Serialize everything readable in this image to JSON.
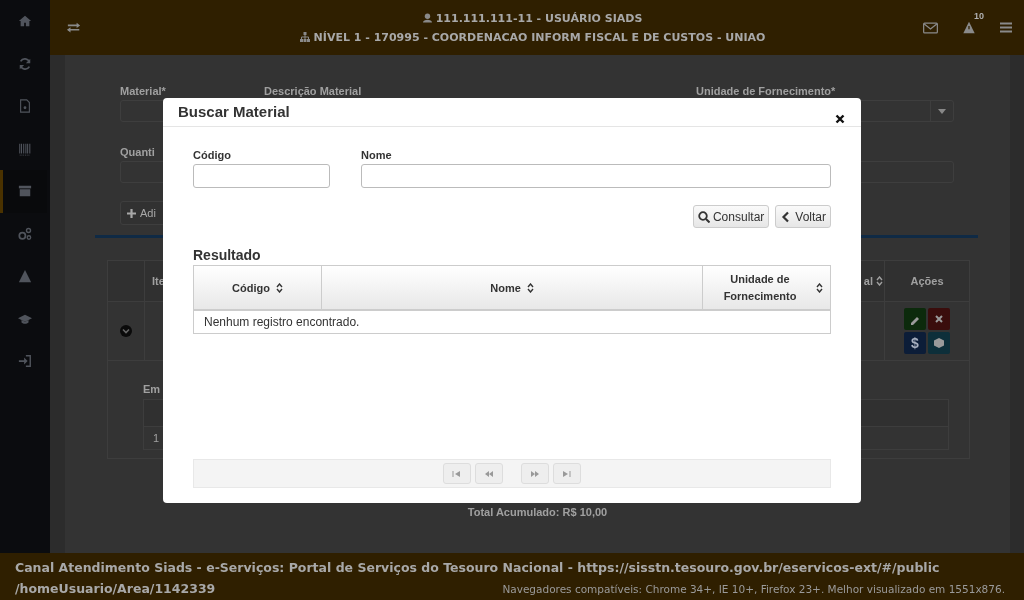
{
  "sidebar": {
    "items": [
      {
        "kind": "home",
        "selected": false
      },
      {
        "kind": "refresh",
        "selected": false
      },
      {
        "kind": "document",
        "selected": false
      },
      {
        "kind": "barcode",
        "selected": false
      },
      {
        "kind": "archive",
        "selected": true
      },
      {
        "kind": "gears",
        "selected": false
      },
      {
        "kind": "warning",
        "selected": false
      },
      {
        "kind": "graduation",
        "selected": false
      },
      {
        "kind": "signin",
        "selected": false
      }
    ]
  },
  "header": {
    "user": "111.111.111-11 - USUÁRIO SIADS",
    "unit": "NÍVEL 1 - 170995 - COORDENACAO INFORM FISCAL E DE CUSTOS - UNIAO",
    "alert_count": "10"
  },
  "form": {
    "labels": [
      "Material*",
      "Descrição Material",
      "Unidade de Fornecimento*"
    ],
    "quantity_label": "Quanti",
    "add_button": "Adi"
  },
  "items_table": {
    "columns": [
      "Ite",
      "al",
      "Ações"
    ],
    "row": {
      "expanded": true,
      "actions": [
        {
          "kind": "edit"
        },
        {
          "kind": "delete"
        },
        {
          "kind": "money",
          "label": "$"
        },
        {
          "kind": "box"
        }
      ]
    },
    "detail_label": "Em",
    "detail_cell": "1"
  },
  "total": "Total Acumulado: R$ 10,00",
  "modal": {
    "title": "Buscar Material",
    "fields": [
      {
        "label": "Código"
      },
      {
        "label": "Nome"
      }
    ],
    "buttons": [
      {
        "kind": "search",
        "label": "Consultar"
      },
      {
        "kind": "back",
        "label": "Voltar"
      }
    ],
    "result_title": "Resultado",
    "columns": [
      {
        "label": "Código"
      },
      {
        "label": "Unidade de Fornecimento"
      }
    ],
    "name_column": "Nome",
    "empty_text": "Nenhum registro encontrado.",
    "pagination": [
      {
        "kind": "first",
        "disabled": true
      },
      {
        "kind": "prev",
        "disabled": true
      },
      {
        "kind": "next",
        "disabled": true
      },
      {
        "kind": "last",
        "disabled": true
      }
    ]
  },
  "footer": {
    "lines": [
      "Canal Atendimento Siads - e-Serviços: Portal de Serviços do Tesouro Nacional - https://sisstn.tesouro.gov.br/eservicos-ext/#/public",
      "/homeUsuario/Area/1142339"
    ],
    "browsers": "Navegadores compatíveis: Chrome 34+, IE 10+, Firefox 23+. Melhor visualizado em 1551x876."
  }
}
